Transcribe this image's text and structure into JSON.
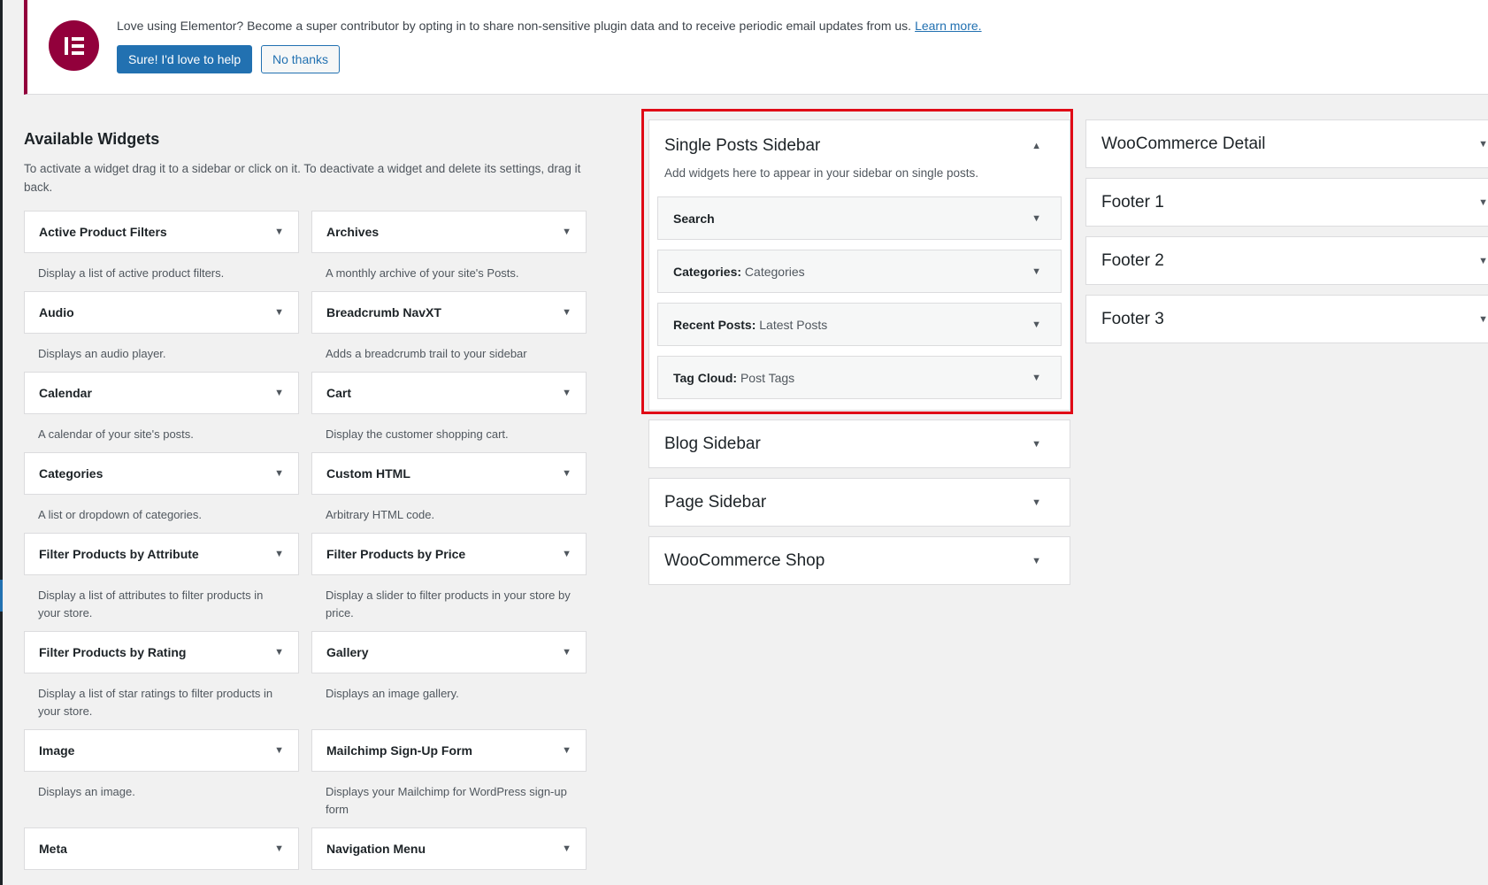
{
  "notice": {
    "message": "Love using Elementor? Become a super contributor by opting in to share non-sensitive plugin data and to receive periodic email updates from us.",
    "link": "Learn more.",
    "primary_button": "Sure! I'd love to help",
    "secondary_button": "No thanks",
    "brand_color": "#92003b"
  },
  "available": {
    "title": "Available Widgets",
    "description": "To activate a widget drag it to a sidebar or click on it. To deactivate a widget and delete its settings, drag it back.",
    "widgets": [
      {
        "name": "Active Product Filters",
        "desc": "Display a list of active product filters."
      },
      {
        "name": "Archives",
        "desc": "A monthly archive of your site's Posts."
      },
      {
        "name": "Audio",
        "desc": "Displays an audio player."
      },
      {
        "name": "Breadcrumb NavXT",
        "desc": "Adds a breadcrumb trail to your sidebar"
      },
      {
        "name": "Calendar",
        "desc": "A calendar of your site's posts."
      },
      {
        "name": "Cart",
        "desc": "Display the customer shopping cart."
      },
      {
        "name": "Categories",
        "desc": "A list or dropdown of categories."
      },
      {
        "name": "Custom HTML",
        "desc": "Arbitrary HTML code."
      },
      {
        "name": "Filter Products by Attribute",
        "desc": "Display a list of attributes to filter products in your store."
      },
      {
        "name": "Filter Products by Price",
        "desc": "Display a slider to filter products in your store by price."
      },
      {
        "name": "Filter Products by Rating",
        "desc": "Display a list of star ratings to filter products in your store."
      },
      {
        "name": "Gallery",
        "desc": "Displays an image gallery."
      },
      {
        "name": "Image",
        "desc": "Displays an image."
      },
      {
        "name": "Mailchimp Sign-Up Form",
        "desc": "Displays your Mailchimp for WordPress sign-up form"
      },
      {
        "name": "Meta",
        "desc": ""
      },
      {
        "name": "Navigation Menu",
        "desc": ""
      }
    ]
  },
  "single_sidebar": {
    "title": "Single Posts Sidebar",
    "description": "Add widgets here to appear in your sidebar on single posts.",
    "widgets": [
      {
        "title": "Search",
        "subtitle": ""
      },
      {
        "title": "Categories:",
        "subtitle": "Categories"
      },
      {
        "title": "Recent Posts:",
        "subtitle": "Latest Posts"
      },
      {
        "title": "Tag Cloud:",
        "subtitle": "Post Tags"
      }
    ]
  },
  "middle_sidebars": [
    "Blog Sidebar",
    "Page Sidebar",
    "WooCommerce Shop"
  ],
  "right_sidebars": [
    "WooCommerce Detail",
    "Footer 1",
    "Footer 2",
    "Footer 3"
  ],
  "icons": {
    "caret_down": "caret-down-icon",
    "caret_up": "caret-up-icon",
    "logo": "elementor-logo-icon"
  },
  "colors": {
    "primary": "#2271b1",
    "highlight": "#e00a16"
  }
}
